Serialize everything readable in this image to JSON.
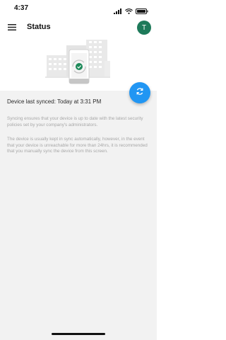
{
  "status_bar": {
    "time": "4:37"
  },
  "header": {
    "title": "Status",
    "avatar_initial": "T"
  },
  "main": {
    "last_synced": "Device last synced: Today at 3:31 PM",
    "paragraph_1": "Syncing ensures that your device is up to date with the latest security policies set by your company's administrators.",
    "paragraph_2": "The device is usually kept in sync automatically, however, in the event that your device is unreachable for more than 24hrs, it is recommended that you manually sync the device from this screen."
  },
  "icons": {
    "menu": "menu-icon",
    "sync": "sync-icon",
    "wifi": "wifi-icon",
    "battery": "battery-icon"
  },
  "colors": {
    "accent": "#2196f3",
    "avatar": "#1e7a5a",
    "check": "#1e8a5a"
  }
}
